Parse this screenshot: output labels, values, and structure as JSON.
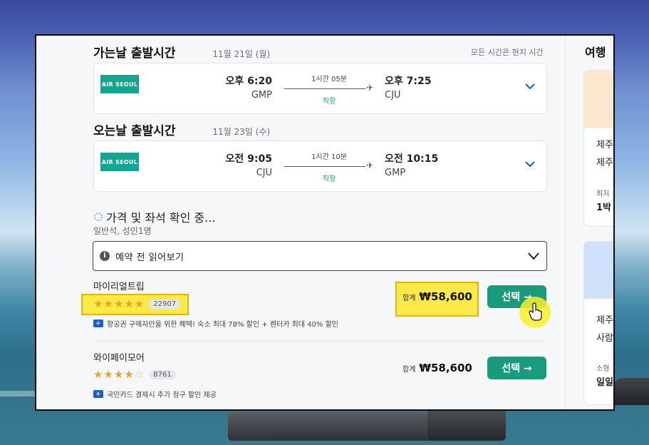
{
  "outbound": {
    "title": "가는날 출발시간",
    "date": "11월 21일 (월)",
    "tz_note": "모든 시간은 현지 시간",
    "airline": "AIR SEOUL",
    "dep_time": "오후 6:20",
    "dep_code": "GMP",
    "duration": "1시간 05분",
    "direct": "직항",
    "arr_time": "오후 7:25",
    "arr_code": "CJU"
  },
  "inbound": {
    "title": "오는날 출발시간",
    "date": "11월 23일 (수)",
    "airline": "AIR SEOUL",
    "dep_time": "오전 9:05",
    "dep_code": "CJU",
    "duration": "1시간 10분",
    "direct": "직항",
    "arr_time": "오전 10:15",
    "arr_code": "GMP"
  },
  "status": {
    "checking": "가격 및 좌석 확인 중...",
    "cabin": "일반석, 성인1명"
  },
  "notice": {
    "label": "예약 전 읽어보기"
  },
  "offers": [
    {
      "vendor": "마이리얼트립",
      "rating": 5,
      "reviews": "22907",
      "promo": "항공권 구매자만을 위한 혜택! 숙소 최대 78% 할인 + 렌터카 최대 40% 할인",
      "total_label": "합계",
      "price": "₩58,600",
      "select_label": "선택 →"
    },
    {
      "vendor": "와이페이모어",
      "rating": 4.5,
      "reviews": "8761",
      "promo": "국민카드 결제시 추가 청구 할인 제공",
      "total_label": "합계",
      "price": "₩58,600",
      "select_label": "선택 →"
    }
  ],
  "sidebar": {
    "title": "여행",
    "card1": {
      "line1": "제주",
      "line2": "제주",
      "small": "최저",
      "line3": "1박"
    },
    "card2": {
      "line1": "제주",
      "line2": "사람",
      "small": "소형",
      "line3": "일일"
    }
  },
  "colors": {
    "accent": "#1a9b7e",
    "airline": "#13a58f",
    "star": "#f0a020",
    "highlight": "#fbe94a",
    "promo": "#1e5cc8"
  }
}
